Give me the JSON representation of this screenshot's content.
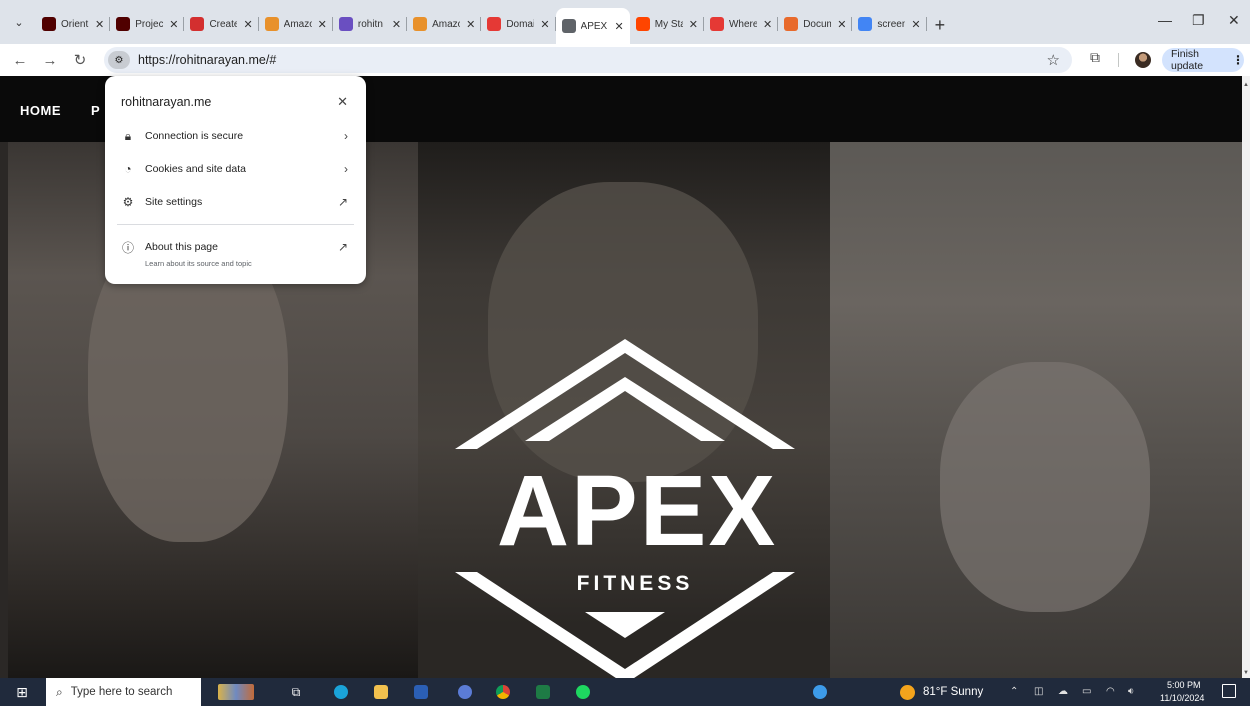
{
  "browser": {
    "tabs": [
      {
        "label": "Orient",
        "favicon": "atm",
        "color": "#500000",
        "active": false
      },
      {
        "label": "Project",
        "favicon": "atm",
        "color": "#500000",
        "active": false
      },
      {
        "label": "Create",
        "favicon": "create-logo",
        "color": "#d32f2f",
        "active": false
      },
      {
        "label": "Amazo",
        "favicon": "box",
        "color": "#e8912b",
        "active": false
      },
      {
        "label": "rohitn",
        "favicon": "site",
        "color": "#6a4fc1",
        "active": false
      },
      {
        "label": "Amazo",
        "favicon": "box",
        "color": "#e8912b",
        "active": false
      },
      {
        "label": "Domai",
        "favicon": "n-logo",
        "color": "#e53935",
        "active": false
      },
      {
        "label": "APEX",
        "favicon": "globe",
        "color": "#5f6368",
        "active": true
      },
      {
        "label": "My Sta",
        "favicon": "reddit",
        "color": "#ff4500",
        "active": false
      },
      {
        "label": "Where",
        "favicon": "n-logo",
        "color": "#e53935",
        "active": false
      },
      {
        "label": "Docum",
        "favicon": "asterisk",
        "color": "#e86a2c",
        "active": false
      },
      {
        "label": "screen",
        "favicon": "google",
        "color": "#4285f4",
        "active": false
      }
    ],
    "url": "https://rohitnarayan.me/#",
    "finish_update": "Finish update"
  },
  "site_info": {
    "title": "rohitnarayan.me",
    "items": [
      {
        "label": "Connection is secure",
        "icon": "lock-icon",
        "trail": "›"
      },
      {
        "label": "Cookies and site data",
        "icon": "cookie-icon",
        "trail": "›"
      },
      {
        "label": "Site settings",
        "icon": "settings-icon",
        "trail": "↗"
      }
    ],
    "about": {
      "label": "About this page",
      "sub": "Learn about its source and topic",
      "icon": "info-icon",
      "trail": "↗"
    }
  },
  "website": {
    "nav_home": "HOME",
    "nav_p": "P",
    "logo_text": "APEX",
    "logo_sub": "FITNESS"
  },
  "taskbar": {
    "search_placeholder": "Type here to search",
    "weather": "81°F  Sunny",
    "time": "5:00 PM",
    "date": "11/10/2024"
  }
}
